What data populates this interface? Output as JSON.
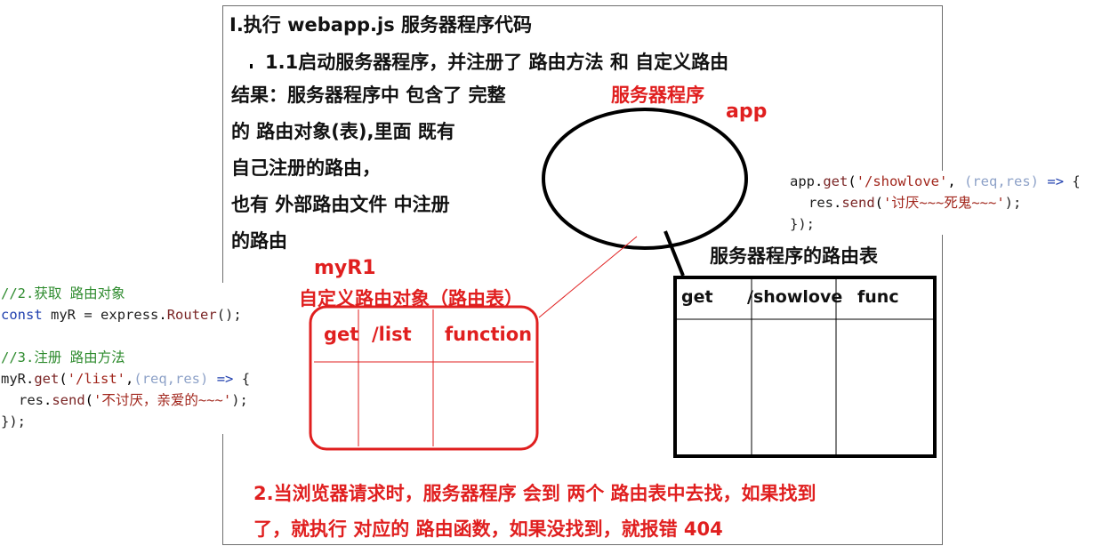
{
  "heading": "I.执行 webapp.js 服务器程序代码",
  "subheading": "1.1启动服务器程序，并注册了 路由方法 和 自定义路由",
  "result_lines": [
    "结果：服务器程序中 包含了 完整",
    "的 路由对象(表),里面 既有",
    "自己注册的路由，",
    "也有 外部路由文件 中注册",
    "的路由"
  ],
  "server_label": "服务器程序",
  "app_label": "app",
  "myr1_label": "myR1",
  "custom_router_label": "自定义路由对象（路由表）",
  "server_route_table_label": "服务器程序的路由表",
  "left_table": {
    "method": "get",
    "path": "/list",
    "handler": "function"
  },
  "right_table": {
    "method": "get",
    "path": "/showlove",
    "handler": "func"
  },
  "bottom_lines": [
    "2.当浏览器请求时，服务器程序 会到 两个 路由表中去找，如果找到",
    "了，就执行 对应的 路由函数，如果没找到，就报错 404"
  ],
  "code_right": {
    "line1": {
      "obj": "app",
      "method": "get",
      "path": "'/showlove'",
      "params": "(req,res)",
      "arrow": "=>",
      "brace": "{"
    },
    "line2": {
      "obj": "res",
      "method": "send",
      "arg": "'讨厌~~~死鬼~~~'",
      "end": ");"
    },
    "line3": "});"
  },
  "code_left": {
    "comment1": "//2.获取 路由对象",
    "line2": {
      "kw": "const",
      "var": "myR",
      "eq": "=",
      "obj": "express",
      "method": "Router",
      "end": "();"
    },
    "comment2": "//3.注册 路由方法",
    "line4": {
      "obj": "myR",
      "method": "get",
      "path": "'/list'",
      "params": "(req,res)",
      "arrow": "=>",
      "brace": "{"
    },
    "line5": {
      "obj": "res",
      "method": "send",
      "arg": "'不讨厌，亲爱的~~~'",
      "end": ");"
    },
    "line6": "});"
  }
}
